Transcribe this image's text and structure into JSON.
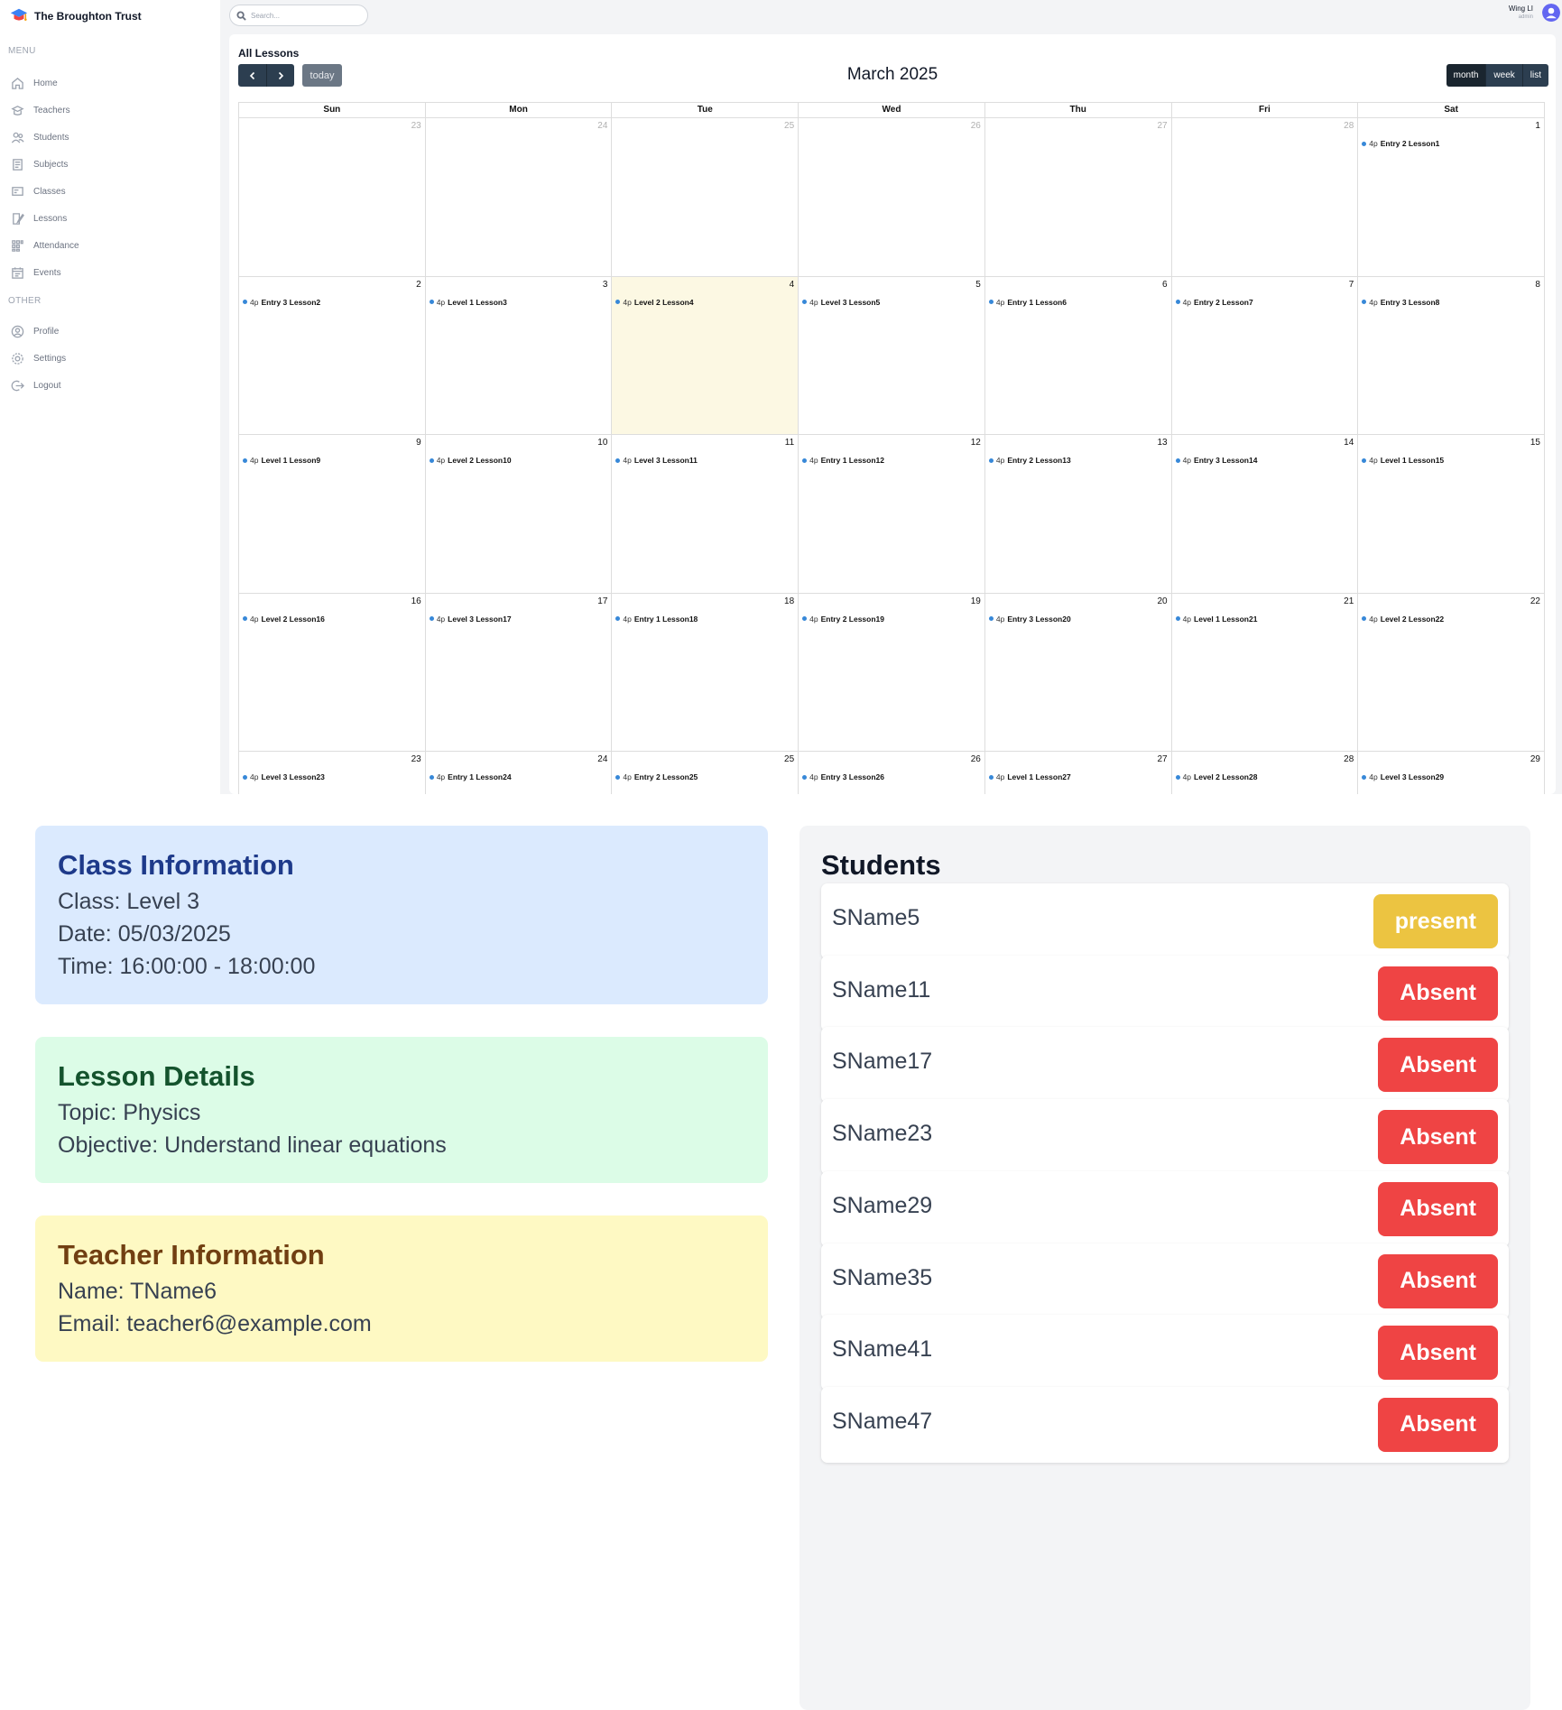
{
  "brand": {
    "name": "The Broughton Trust"
  },
  "sidebar": {
    "menu_label": "MENU",
    "other_label": "OTHER",
    "menu": [
      {
        "label": "Home",
        "icon": "home-icon"
      },
      {
        "label": "Teachers",
        "icon": "teacher-icon"
      },
      {
        "label": "Students",
        "icon": "students-icon"
      },
      {
        "label": "Subjects",
        "icon": "subject-icon"
      },
      {
        "label": "Classes",
        "icon": "class-icon"
      },
      {
        "label": "Lessons",
        "icon": "lesson-icon"
      },
      {
        "label": "Attendance",
        "icon": "attendance-icon"
      },
      {
        "label": "Events",
        "icon": "calendar-icon"
      }
    ],
    "other": [
      {
        "label": "Profile",
        "icon": "profile-icon"
      },
      {
        "label": "Settings",
        "icon": "settings-icon"
      },
      {
        "label": "Logout",
        "icon": "logout-icon"
      }
    ]
  },
  "search": {
    "placeholder": "Search..."
  },
  "user": {
    "name": "Wing LI",
    "role": "admin"
  },
  "calendar": {
    "title": "All Lessons",
    "month_label": "March 2025",
    "today_label": "today",
    "views": [
      "month",
      "week",
      "list"
    ],
    "weekdays": [
      "Sun",
      "Mon",
      "Tue",
      "Wed",
      "Thu",
      "Fri",
      "Sat"
    ],
    "weeks": [
      [
        {
          "day": "23",
          "other": true
        },
        {
          "day": "24",
          "other": true
        },
        {
          "day": "25",
          "other": true
        },
        {
          "day": "26",
          "other": true
        },
        {
          "day": "27",
          "other": true
        },
        {
          "day": "28",
          "other": true
        },
        {
          "day": "1",
          "event_time": "4p",
          "event_title": "Entry 2 Lesson1"
        }
      ],
      [
        {
          "day": "2",
          "event_time": "4p",
          "event_title": "Entry 3 Lesson2"
        },
        {
          "day": "3",
          "event_time": "4p",
          "event_title": "Level 1 Lesson3"
        },
        {
          "day": "4",
          "today": true,
          "event_time": "4p",
          "event_title": "Level 2 Lesson4"
        },
        {
          "day": "5",
          "event_time": "4p",
          "event_title": "Level 3 Lesson5"
        },
        {
          "day": "6",
          "event_time": "4p",
          "event_title": "Entry 1 Lesson6"
        },
        {
          "day": "7",
          "event_time": "4p",
          "event_title": "Entry 2 Lesson7"
        },
        {
          "day": "8",
          "event_time": "4p",
          "event_title": "Entry 3 Lesson8"
        }
      ],
      [
        {
          "day": "9",
          "event_time": "4p",
          "event_title": "Level 1 Lesson9"
        },
        {
          "day": "10",
          "event_time": "4p",
          "event_title": "Level 2 Lesson10"
        },
        {
          "day": "11",
          "event_time": "4p",
          "event_title": "Level 3 Lesson11"
        },
        {
          "day": "12",
          "event_time": "4p",
          "event_title": "Entry 1 Lesson12"
        },
        {
          "day": "13",
          "event_time": "4p",
          "event_title": "Entry 2 Lesson13"
        },
        {
          "day": "14",
          "event_time": "4p",
          "event_title": "Entry 3 Lesson14"
        },
        {
          "day": "15",
          "event_time": "4p",
          "event_title": "Level 1 Lesson15"
        }
      ],
      [
        {
          "day": "16",
          "event_time": "4p",
          "event_title": "Level 2 Lesson16"
        },
        {
          "day": "17",
          "event_time": "4p",
          "event_title": "Level 3 Lesson17"
        },
        {
          "day": "18",
          "event_time": "4p",
          "event_title": "Entry 1 Lesson18"
        },
        {
          "day": "19",
          "event_time": "4p",
          "event_title": "Entry 2 Lesson19"
        },
        {
          "day": "20",
          "event_time": "4p",
          "event_title": "Entry 3 Lesson20"
        },
        {
          "day": "21",
          "event_time": "4p",
          "event_title": "Level 1 Lesson21"
        },
        {
          "day": "22",
          "event_time": "4p",
          "event_title": "Level 2 Lesson22"
        }
      ],
      [
        {
          "day": "23",
          "event_time": "4p",
          "event_title": "Level 3 Lesson23"
        },
        {
          "day": "24",
          "event_time": "4p",
          "event_title": "Entry 1 Lesson24"
        },
        {
          "day": "25",
          "event_time": "4p",
          "event_title": "Entry 2 Lesson25"
        },
        {
          "day": "26",
          "event_time": "4p",
          "event_title": "Entry 3 Lesson26"
        },
        {
          "day": "27",
          "event_time": "4p",
          "event_title": "Level 1 Lesson27"
        },
        {
          "day": "28",
          "event_time": "4p",
          "event_title": "Level 2 Lesson28"
        },
        {
          "day": "29",
          "event_time": "4p",
          "event_title": "Level 3 Lesson29"
        }
      ]
    ]
  },
  "class_info": {
    "heading": "Class Information",
    "class_line": "Class: Level 3",
    "date_line": "Date: 05/03/2025",
    "time_line": "Time: 16:00:00 - 18:00:00"
  },
  "lesson_details": {
    "heading": "Lesson Details",
    "topic_line": "Topic: Physics",
    "objective_line": "Objective: Understand linear equations"
  },
  "teacher_info": {
    "heading": "Teacher Information",
    "name_line": "Name: TName6",
    "email_line": "Email: teacher6@example.com"
  },
  "students": {
    "heading": "Students",
    "list": [
      {
        "name": "SName5",
        "status": "present",
        "state": "present"
      },
      {
        "name": "SName11",
        "status": "Absent",
        "state": "absent"
      },
      {
        "name": "SName17",
        "status": "Absent",
        "state": "absent"
      },
      {
        "name": "SName23",
        "status": "Absent",
        "state": "absent"
      },
      {
        "name": "SName29",
        "status": "Absent",
        "state": "absent"
      },
      {
        "name": "SName35",
        "status": "Absent",
        "state": "absent"
      },
      {
        "name": "SName41",
        "status": "Absent",
        "state": "absent"
      },
      {
        "name": "SName47",
        "status": "Absent",
        "state": "absent"
      }
    ]
  },
  "colors": {
    "event_dot": "#3788d8",
    "today_bg": "#fcf8e3",
    "absent": "#ef4444",
    "present": "#ecc441",
    "toolbar": "#2c3e50"
  }
}
